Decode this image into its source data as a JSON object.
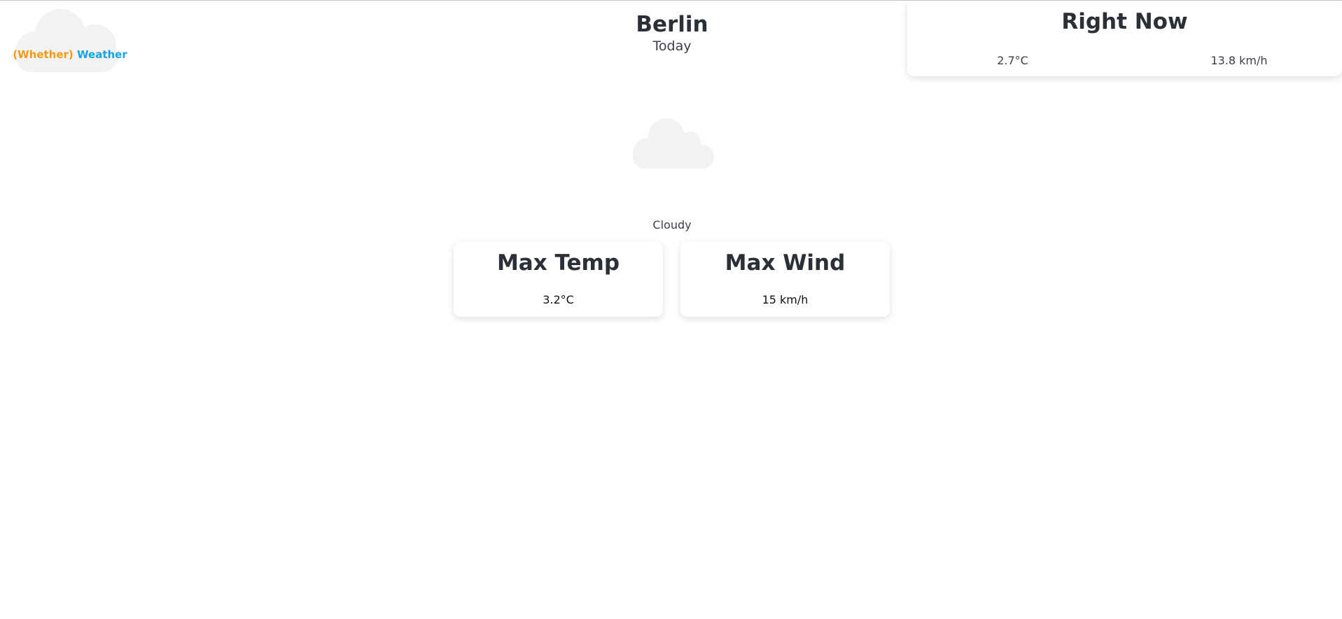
{
  "logo": {
    "part1": "(Whether)",
    "part2": "Weather",
    "colors": {
      "part1": "#f29a13",
      "part2": "#14a5dc",
      "cloud": "#f2f2f2"
    },
    "icon": "cloud-icon"
  },
  "header": {
    "city": "Berlin",
    "day": "Today"
  },
  "right_now": {
    "title": "Right Now",
    "temperature": "2.7°C",
    "wind": "13.8 km/h"
  },
  "condition": {
    "icon": "cloud-icon",
    "label": "Cloudy"
  },
  "stats": {
    "max_temp": {
      "title": "Max Temp",
      "value": "3.2°C"
    },
    "max_wind": {
      "title": "Max Wind",
      "value": "15 km/h"
    }
  }
}
